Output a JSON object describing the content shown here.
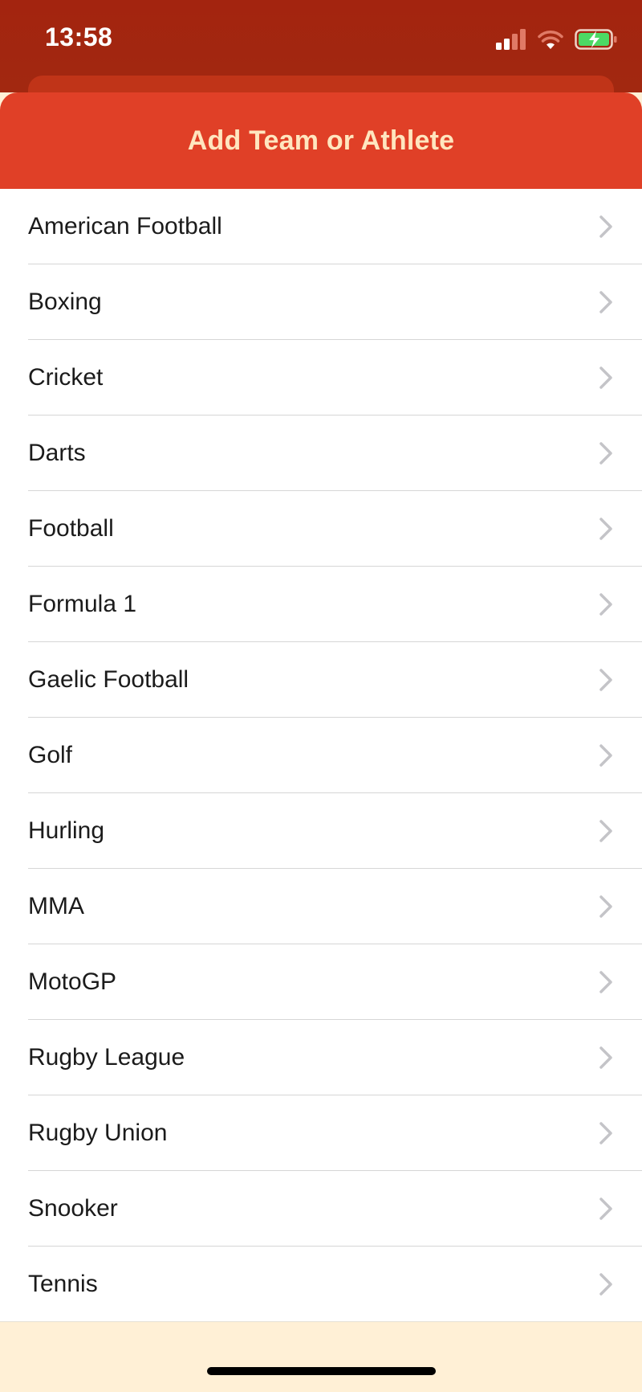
{
  "status_bar": {
    "time": "13:58"
  },
  "sheet": {
    "title": "Add Team or Athlete"
  },
  "sports": [
    {
      "label": "American Football"
    },
    {
      "label": "Boxing"
    },
    {
      "label": "Cricket"
    },
    {
      "label": "Darts"
    },
    {
      "label": "Football"
    },
    {
      "label": "Formula 1"
    },
    {
      "label": "Gaelic Football"
    },
    {
      "label": "Golf"
    },
    {
      "label": "Hurling"
    },
    {
      "label": "MMA"
    },
    {
      "label": "MotoGP"
    },
    {
      "label": "Rugby League"
    },
    {
      "label": "Rugby Union"
    },
    {
      "label": "Snooker"
    },
    {
      "label": "Tennis"
    }
  ],
  "colors": {
    "header_background": "#e04027",
    "header_text": "#ffe6bf",
    "status_background": "#a3240f",
    "footer_background": "#fff0d6",
    "battery_fill": "#4cd964"
  },
  "icons": {
    "row_accessory": "chevron-right-icon",
    "signal": "cellular-signal-icon",
    "wifi": "wifi-icon",
    "battery": "battery-charging-icon"
  }
}
